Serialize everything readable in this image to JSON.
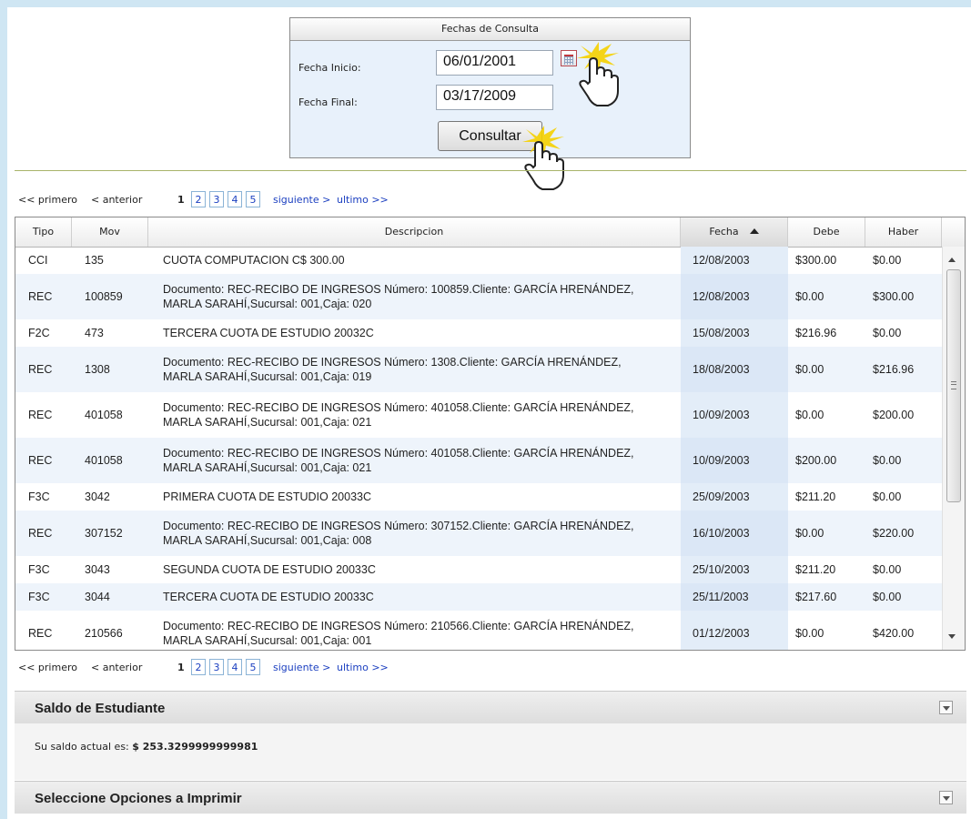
{
  "date_panel": {
    "title": "Fechas de Consulta",
    "start_label": "Fecha Inicio:",
    "start_value": "06/01/2001",
    "end_label": "Fecha Final:",
    "end_value": "03/17/2009",
    "submit_label": "Consultar"
  },
  "pager": {
    "first": "<< primero",
    "prev": "< anterior",
    "current": "1",
    "pages": [
      "2",
      "3",
      "4",
      "5"
    ],
    "next": "siguiente >",
    "last": "ultimo >>"
  },
  "table": {
    "columns": [
      "Tipo",
      "Mov",
      "Descripcion",
      "Fecha",
      "Debe",
      "Haber"
    ],
    "sorted_column": "Fecha",
    "rows": [
      {
        "tipo": "CCI",
        "mov": "135",
        "desc": "CUOTA COMPUTACION C$ 300.00",
        "fecha": "12/08/2003",
        "debe": "$300.00",
        "haber": "$0.00"
      },
      {
        "tipo": "REC",
        "mov": "100859",
        "desc": "Documento: REC-RECIBO DE INGRESOS Número: 100859.Cliente: GARCÍA HRENÁNDEZ, MARLA SARAHÍ,Sucursal: 001,Caja: 020",
        "fecha": "12/08/2003",
        "debe": "$0.00",
        "haber": "$300.00"
      },
      {
        "tipo": "F2C",
        "mov": "473",
        "desc": "TERCERA CUOTA DE ESTUDIO 20032C",
        "fecha": "15/08/2003",
        "debe": "$216.96",
        "haber": "$0.00"
      },
      {
        "tipo": "REC",
        "mov": "1308",
        "desc": "Documento: REC-RECIBO DE INGRESOS Número: 1308.Cliente: GARCÍA HRENÁNDEZ, MARLA SARAHÍ,Sucursal: 001,Caja: 019",
        "fecha": "18/08/2003",
        "debe": "$0.00",
        "haber": "$216.96"
      },
      {
        "tipo": "REC",
        "mov": "401058",
        "desc": "Documento: REC-RECIBO DE INGRESOS Número: 401058.Cliente: GARCÍA HRENÁNDEZ, MARLA SARAHÍ,Sucursal: 001,Caja: 021",
        "fecha": "10/09/2003",
        "debe": "$0.00",
        "haber": "$200.00"
      },
      {
        "tipo": "REC",
        "mov": "401058",
        "desc": "Documento: REC-RECIBO DE INGRESOS Número: 401058.Cliente: GARCÍA HRENÁNDEZ, MARLA SARAHÍ,Sucursal: 001,Caja: 021",
        "fecha": "10/09/2003",
        "debe": "$200.00",
        "haber": "$0.00"
      },
      {
        "tipo": "F3C",
        "mov": "3042",
        "desc": "PRIMERA CUOTA DE ESTUDIO 20033C",
        "fecha": "25/09/2003",
        "debe": "$211.20",
        "haber": "$0.00"
      },
      {
        "tipo": "REC",
        "mov": "307152",
        "desc": "Documento: REC-RECIBO DE INGRESOS Número: 307152.Cliente: GARCÍA HRENÁNDEZ, MARLA SARAHÍ,Sucursal: 001,Caja: 008",
        "fecha": "16/10/2003",
        "debe": "$0.00",
        "haber": "$220.00"
      },
      {
        "tipo": "F3C",
        "mov": "3043",
        "desc": "SEGUNDA CUOTA DE ESTUDIO 20033C",
        "fecha": "25/10/2003",
        "debe": "$211.20",
        "haber": "$0.00"
      },
      {
        "tipo": "F3C",
        "mov": "3044",
        "desc": "TERCERA CUOTA DE ESTUDIO 20033C",
        "fecha": "25/11/2003",
        "debe": "$217.60",
        "haber": "$0.00"
      },
      {
        "tipo": "REC",
        "mov": "210566",
        "desc": "Documento: REC-RECIBO DE INGRESOS Número: 210566.Cliente: GARCÍA HRENÁNDEZ, MARLA SARAHÍ,Sucursal: 001,Caja: 001",
        "fecha": "01/12/2003",
        "debe": "$0.00",
        "haber": "$420.00"
      }
    ]
  },
  "saldo": {
    "title": "Saldo de Estudiante",
    "label": "Su saldo actual es:",
    "value": "$ 253.3299999999981"
  },
  "imprimir": {
    "title": "Seleccione Opciones a Imprimir"
  },
  "colors": {
    "link": "#1b3fc0",
    "panel_bg": "#e8f1fb",
    "alt_row": "#eef4fb",
    "highlight": "#f5d000"
  },
  "icons": [
    "calendar-icon",
    "sort-ascending-icon",
    "scroll-up-icon",
    "scroll-down-icon",
    "chevron-down-icon",
    "hand-cursor-icon"
  ]
}
